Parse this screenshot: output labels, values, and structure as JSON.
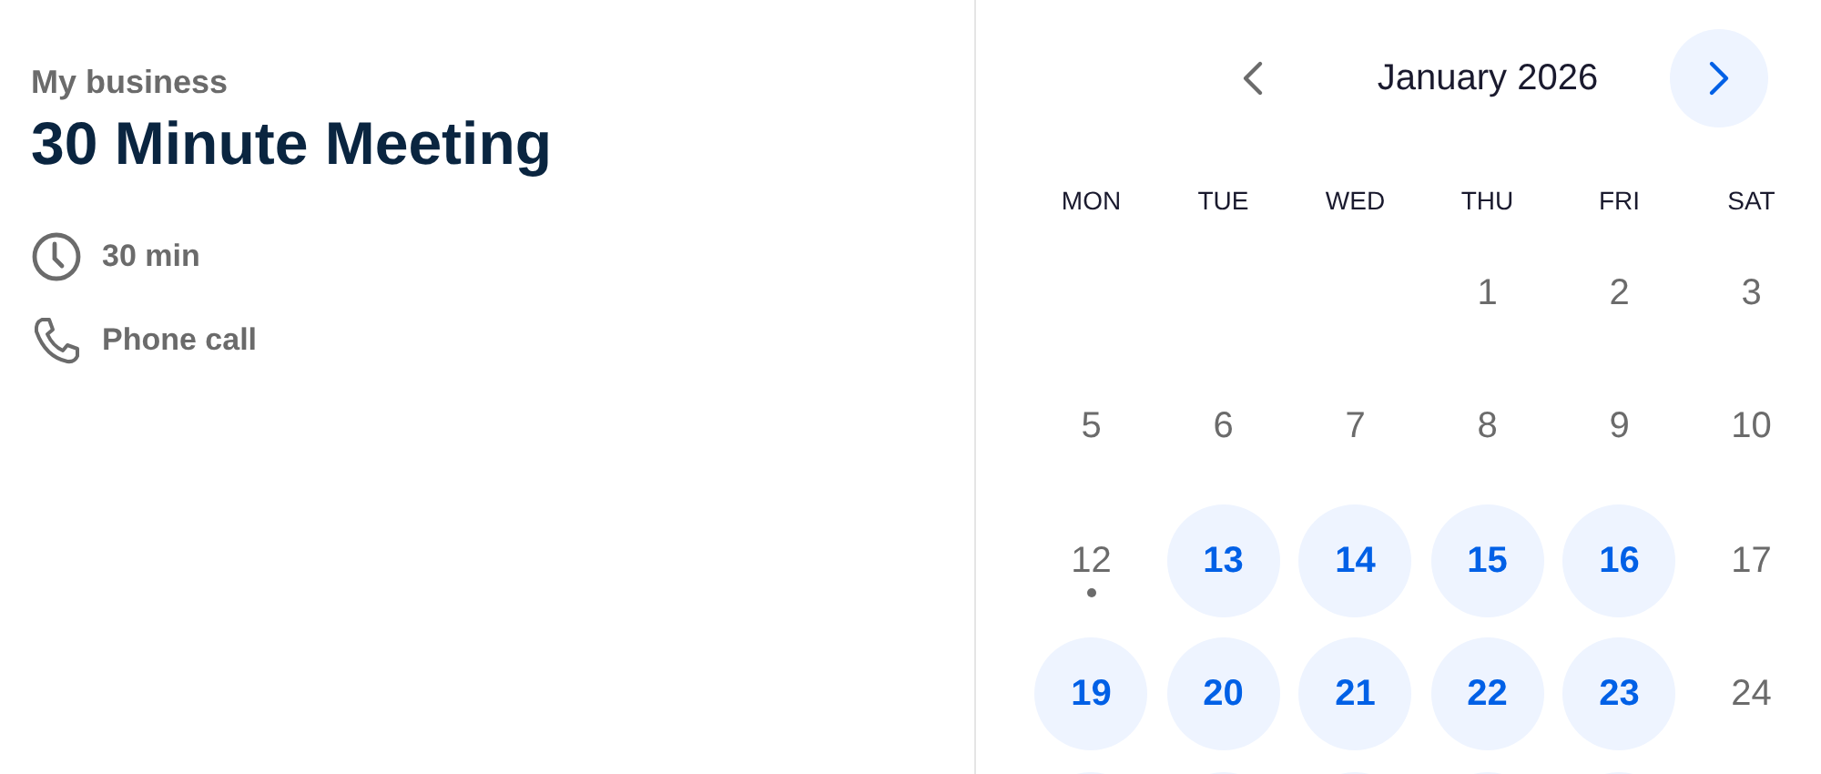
{
  "organizer": "My business",
  "event_title": "30 Minute Meeting",
  "details": [
    {
      "kind": "duration",
      "text": "30 min"
    },
    {
      "kind": "phone",
      "text": "Phone call"
    }
  ],
  "calendar": {
    "month": "January 2026",
    "weekdays": [
      "MON",
      "TUE",
      "WED",
      "THU",
      "FRI",
      "SAT"
    ],
    "weeks": [
      {
        "right_aligned": true,
        "days": [
          {
            "day": "1",
            "available": false
          },
          {
            "day": "2",
            "available": false
          },
          {
            "day": "3",
            "available": false
          }
        ]
      },
      {
        "days": [
          {
            "day": "5",
            "available": false
          },
          {
            "day": "6",
            "available": false
          },
          {
            "day": "7",
            "available": false
          },
          {
            "day": "8",
            "available": false
          },
          {
            "day": "9",
            "available": false
          },
          {
            "day": "10",
            "available": false
          }
        ]
      },
      {
        "days": [
          {
            "day": "12",
            "available": false,
            "today": true
          },
          {
            "day": "13",
            "available": true
          },
          {
            "day": "14",
            "available": true
          },
          {
            "day": "15",
            "available": true
          },
          {
            "day": "16",
            "available": true
          },
          {
            "day": "17",
            "available": false
          }
        ]
      },
      {
        "days": [
          {
            "day": "19",
            "available": true
          },
          {
            "day": "20",
            "available": true
          },
          {
            "day": "21",
            "available": true
          },
          {
            "day": "22",
            "available": true
          },
          {
            "day": "23",
            "available": true
          },
          {
            "day": "24",
            "available": false
          }
        ]
      },
      {
        "days": [
          {
            "available": true
          },
          {
            "available": true
          },
          {
            "available": true
          },
          {
            "available": true
          },
          {
            "available": true
          }
        ]
      }
    ]
  }
}
